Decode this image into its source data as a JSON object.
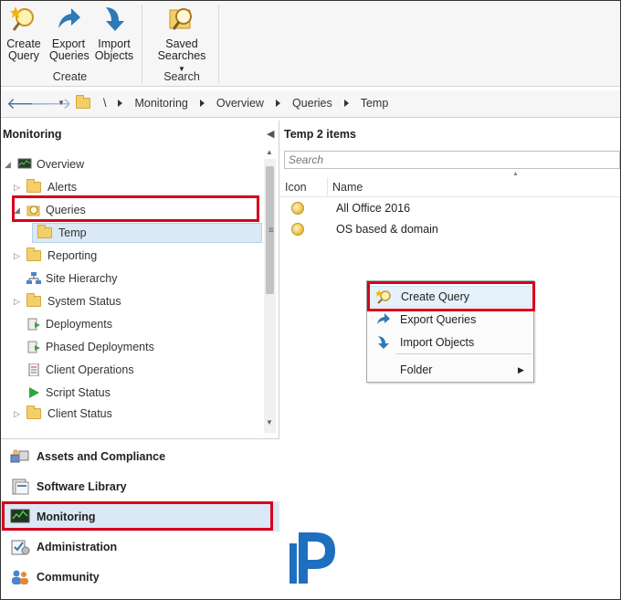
{
  "ribbon": {
    "buttons": [
      {
        "line1": "Create",
        "line2": "Query"
      },
      {
        "line1": "Export",
        "line2": "Queries"
      },
      {
        "line1": "Import",
        "line2": "Objects"
      },
      {
        "line1": "Saved",
        "line2": "Searches"
      }
    ],
    "groups": {
      "create": "Create",
      "search": "Search"
    }
  },
  "address": {
    "crumbs": [
      "\\",
      "Monitoring",
      "Overview",
      "Queries",
      "Temp"
    ]
  },
  "left": {
    "title": "Monitoring",
    "tree": [
      {
        "label": "Overview"
      },
      {
        "label": "Alerts"
      },
      {
        "label": "Queries"
      },
      {
        "label": "Temp"
      },
      {
        "label": "Reporting"
      },
      {
        "label": "Site Hierarchy"
      },
      {
        "label": "System Status"
      },
      {
        "label": "Deployments"
      },
      {
        "label": "Phased Deployments"
      },
      {
        "label": "Client Operations"
      },
      {
        "label": "Script Status"
      },
      {
        "label": "Client Status"
      }
    ],
    "workspaces": [
      {
        "label": "Assets and Compliance"
      },
      {
        "label": "Software Library"
      },
      {
        "label": "Monitoring"
      },
      {
        "label": "Administration"
      },
      {
        "label": "Community"
      }
    ]
  },
  "right": {
    "title": "Temp 2 items",
    "search_placeholder": "Search",
    "columns": {
      "icon": "Icon",
      "name": "Name"
    },
    "rows": [
      {
        "name": "All Office 2016"
      },
      {
        "name": "OS based & domain"
      }
    ]
  },
  "context_menu": {
    "items": [
      {
        "label": "Create Query"
      },
      {
        "label": "Export Queries"
      },
      {
        "label": "Import Objects"
      },
      {
        "label": "Folder"
      }
    ]
  },
  "colors": {
    "highlight": "#d6001c",
    "accent": "#2e7ab8",
    "folder": "#f3cf6b"
  }
}
